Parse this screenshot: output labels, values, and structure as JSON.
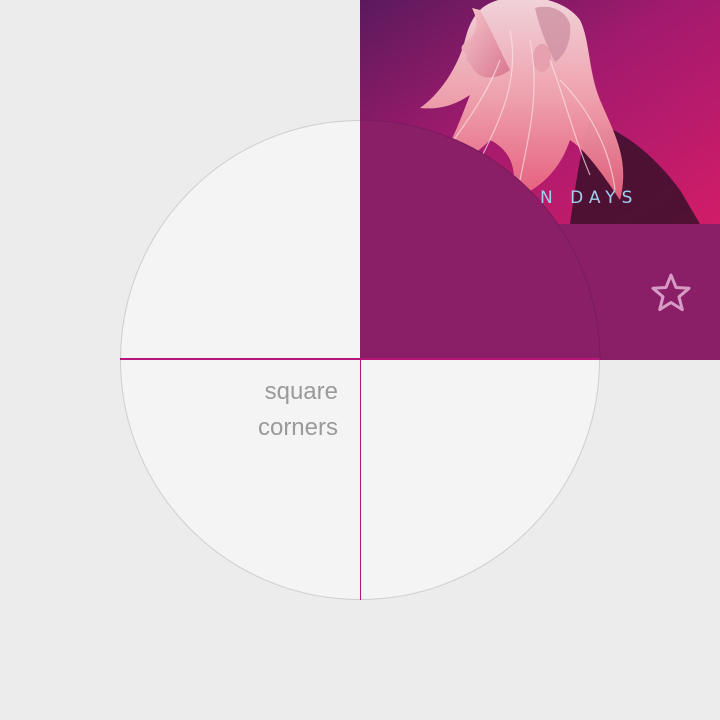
{
  "album": {
    "title_text": "N DAYS"
  },
  "caption": {
    "line1": "square",
    "line2": "corners"
  },
  "icons": {
    "favorite": "star-outline-icon"
  },
  "colors": {
    "background": "#ececec",
    "face": "#f4f4f4",
    "card": "#8a1f68",
    "guide": "#b5167a",
    "album_text": "#9fd0f0",
    "caption": "#9a9a9a"
  }
}
